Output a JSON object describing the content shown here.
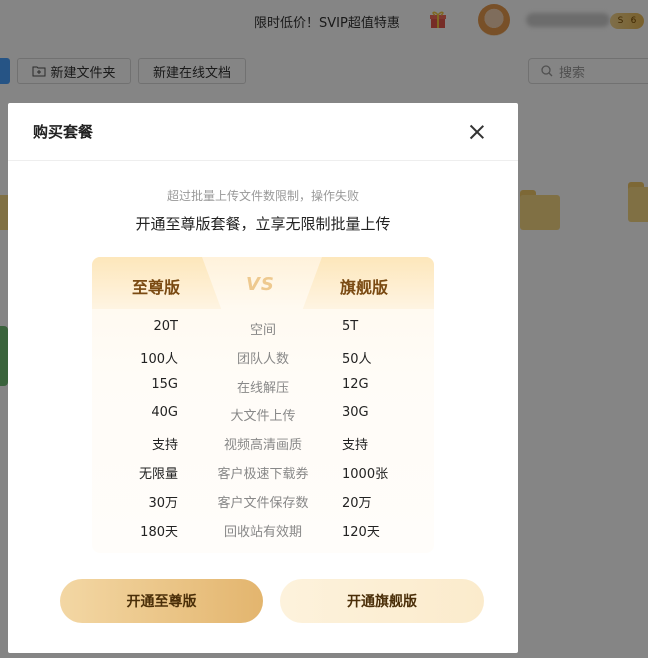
{
  "topbar": {
    "promo_text": "限时低价！SVIP超值特惠",
    "svip_badge": "S",
    "svip_count": "6"
  },
  "toolbar": {
    "new_folder_label": "新建文件夹",
    "new_doc_label": "新建在线文档",
    "search_placeholder": "搜索"
  },
  "modal": {
    "title": "购买套餐",
    "error_text": "超过批量上传文件数限制，操作失败",
    "headline": "开通至尊版套餐，立享无限制批量上传",
    "left_plan": "至尊版",
    "vs": "VS",
    "right_plan": "旗舰版",
    "rows": [
      {
        "left": "20T",
        "feature": "空间",
        "right": "5T"
      },
      {
        "left": "100人",
        "feature": "团队人数",
        "right": "50人"
      },
      {
        "left": "15G",
        "feature": "在线解压",
        "right": "12G"
      },
      {
        "left": "40G",
        "feature": "大文件上传",
        "right": "30G"
      },
      {
        "left": "支持",
        "feature": "视频高清画质",
        "right": "支持"
      },
      {
        "left": "无限量",
        "feature": "客户极速下载券",
        "right": "1000张"
      },
      {
        "left": "30万",
        "feature": "客户文件保存数",
        "right": "20万"
      },
      {
        "left": "180天",
        "feature": "回收站有效期",
        "right": "120天"
      }
    ],
    "btn_supreme": "开通至尊版",
    "btn_flagship": "开通旗舰版"
  },
  "colors": {
    "accent_gold": "#e3b56e",
    "plan_text": "#7a4a12",
    "overlay": "rgba(0,0,0,0.48)"
  }
}
